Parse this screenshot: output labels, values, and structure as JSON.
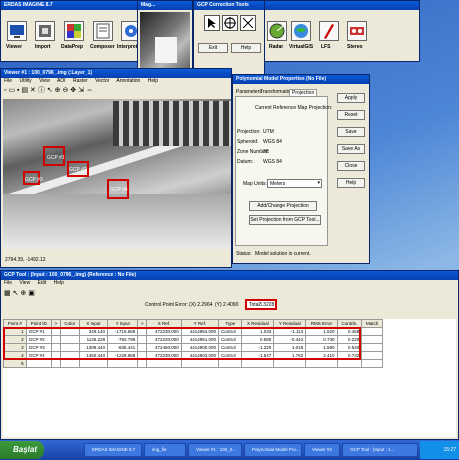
{
  "erdas_window": {
    "title": "ERDAS IMAGINE 8.7",
    "toolbar": [
      "Viewer",
      "Import",
      "DataPrep",
      "Composer",
      "Interpreter"
    ],
    "toolbar_right": [
      "Radar",
      "VirtualGIS",
      "LFS",
      "Stereo"
    ]
  },
  "magnifier_window": {
    "title": "Mag..."
  },
  "gcp_tools_window": {
    "title": "GCP Correction Tools",
    "exit_label": "Exit",
    "help_label": "Help"
  },
  "viewer_window": {
    "title": "Viewer #1 : 100_0796_.img (:Layer_1)",
    "menu": [
      "File",
      "Utility",
      "View",
      "AOI",
      "Raster",
      "Vector",
      "Annotation",
      "Help"
    ],
    "gcp_labels": [
      "GCP #1",
      "GCP #3",
      "GCP #2",
      "GCP #4"
    ],
    "status_coords": "2794.39, -1492.12"
  },
  "model_properties_window": {
    "title": "Polynomial Model Properties (No File)",
    "tabs": [
      "Parameters",
      "Transformation",
      "Projection"
    ],
    "current_label": "Current Reference Map Projection:",
    "projection_label": "Projection:",
    "projection_value": "UTM",
    "spheroid_label": "Spheroid:",
    "spheroid_value": "WGS 84",
    "zone_label": "Zone Number:",
    "zone_value": "38",
    "datum_label": "Datum:",
    "datum_value": "WGS 84",
    "map_units_label": "Map Units:",
    "map_units_value": "Meters",
    "add_change_label": "Add/Change Projection",
    "set_projection_label": "Set Projection from GCP Tool...",
    "status_label": "Status:",
    "status_value": "Model solution is current.",
    "side_buttons": [
      "Apply",
      "Reset",
      "Save",
      "Save As",
      "Close",
      "Help"
    ]
  },
  "gcp_tool_window": {
    "title": "GCP Tool : (Input : 100_0796_.img) (Reference : No File)",
    "menu": [
      "File",
      "View",
      "Edit",
      "Help"
    ],
    "cp_error_label": "Control Point Error: (X) 2.2964",
    "y_error": "(Y) 2.4090",
    "total_label": "Total",
    "total_value": "3.3228",
    "columns": [
      "Point #",
      "Point ID",
      ">",
      "Color",
      "X Input",
      "Y Input",
      ">",
      "X Ref.",
      "Y Ref.",
      "Type",
      "X Residual",
      "Y Residual",
      "RMS Error",
      "Contrib.",
      "Match"
    ],
    "rows": [
      [
        "1",
        "GCP #1",
        "",
        "",
        "346.140",
        "-1715.669",
        "",
        "472230.000",
        "4414954.000",
        "Control",
        "1.033",
        "-1.113",
        "1.520",
        "0.458",
        ""
      ],
      [
        "2",
        "GCP #2",
        "",
        "",
        "1136.228",
        "-792.799",
        "",
        "472220.000",
        "4414951.000",
        "Control",
        "0.580",
        "-0.443",
        "0.730",
        "0.220",
        ""
      ],
      [
        "3",
        "GCP #3",
        "",
        "",
        "1309.440",
        "-835.441",
        "",
        "472450.000",
        "4414900.000",
        "Control",
        "-1.220",
        "1.018",
        "1.590",
        "0.540",
        ""
      ],
      [
        "4",
        "GCP #4",
        "",
        "",
        "1450.440",
        "-1228.968",
        "",
        "472230.000",
        "4414903.000",
        "Control",
        "-1.547",
        "1.763",
        "2.410",
        "0.732",
        ""
      ],
      [
        "5",
        "",
        "",
        "",
        "",
        "",
        "",
        "",
        "",
        "",
        "",
        "",
        "",
        "",
        ""
      ]
    ]
  },
  "taskbar": {
    "start_label": "Başlat",
    "tasks": [
      "ERDAS IMAGINE 8.7",
      "img_fie",
      "Viewer #1 : 100_0...",
      "Polynomial Model Pro...",
      "Viewer #2",
      "GCP Tool : (Input : 1..."
    ],
    "clock": "15:27"
  },
  "colors": {
    "titlebar": "#0a5ad8",
    "highlight": "#d00000",
    "taskbar": "#245edb"
  }
}
